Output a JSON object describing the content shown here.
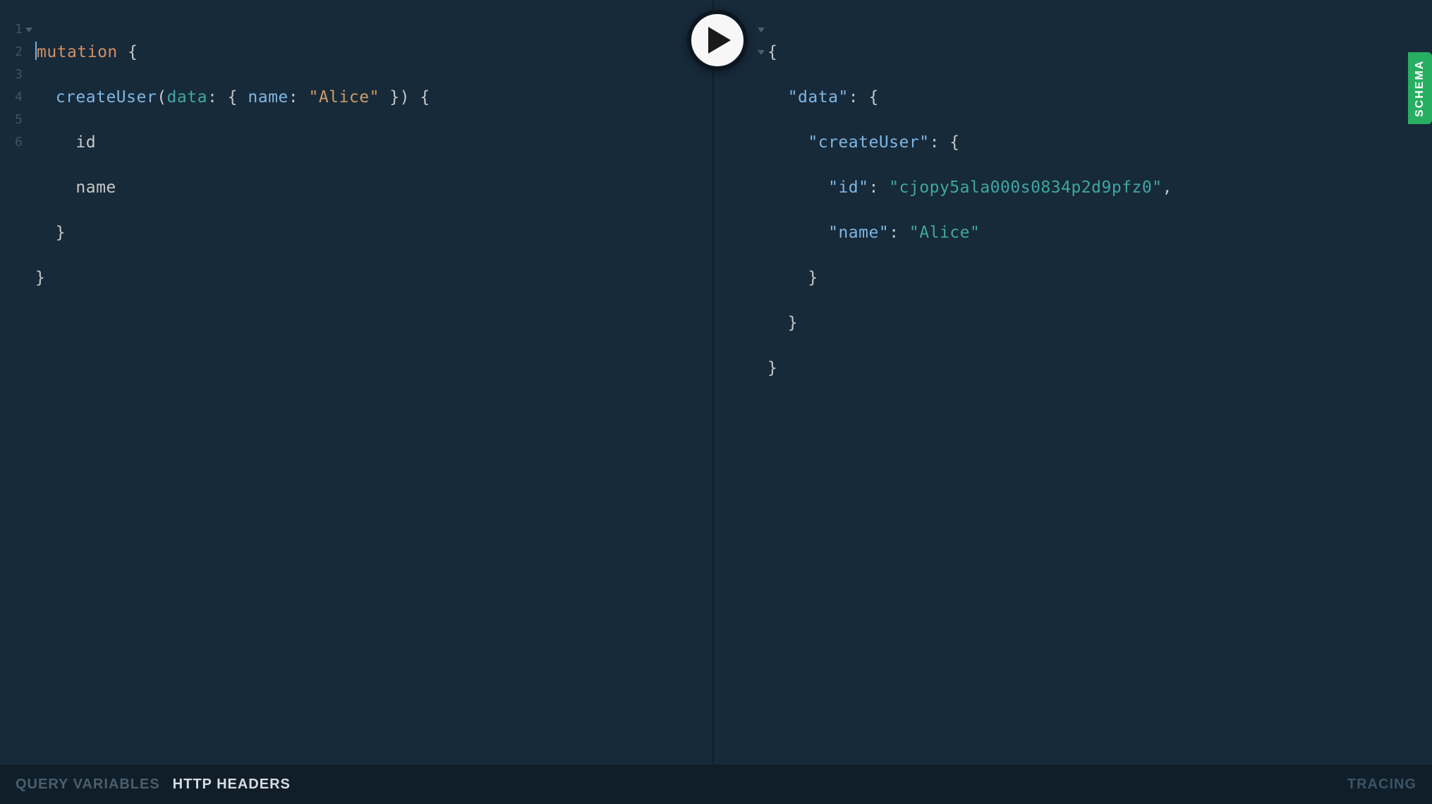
{
  "editor": {
    "line_numbers": [
      "1",
      "2",
      "3",
      "4",
      "5",
      "6"
    ],
    "fold_lines": [
      1
    ],
    "tokens": {
      "mutation": "mutation",
      "createUser": "createUser",
      "data_arg": "data",
      "name_prop": "name",
      "alice_str": "\"Alice\"",
      "id_field": "id",
      "name_field": "name",
      "lbrace": "{",
      "rbrace": "}",
      "lparen": "(",
      "rparen": ")",
      "colon": ":"
    }
  },
  "result": {
    "fold_lines": [
      1,
      2
    ],
    "tokens": {
      "lbrace": "{",
      "rbrace": "}",
      "colon": ":",
      "comma": ",",
      "data_key": "\"data\"",
      "createUser_key": "\"createUser\"",
      "id_key": "\"id\"",
      "id_val": "\"cjopy5ala000s0834p2d9pfz0\"",
      "name_key": "\"name\"",
      "name_val": "\"Alice\""
    }
  },
  "schema_tab": "SCHEMA",
  "footer": {
    "query_variables": "QUERY VARIABLES",
    "http_headers": "HTTP HEADERS",
    "tracing": "TRACING"
  }
}
